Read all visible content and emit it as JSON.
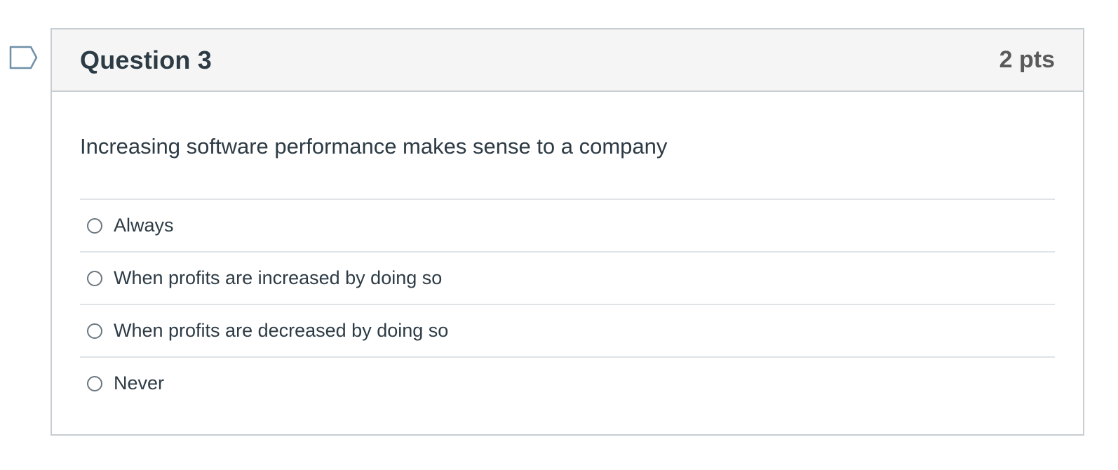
{
  "question": {
    "title": "Question 3",
    "points": "2 pts",
    "text": "Increasing software performance makes sense to a company",
    "flag_icon": "flag-question-icon",
    "answers": [
      {
        "label": "Always",
        "selected": false
      },
      {
        "label": "When profits are increased by doing so",
        "selected": false
      },
      {
        "label": "When profits are decreased by doing so",
        "selected": false
      },
      {
        "label": "Never",
        "selected": false
      }
    ]
  },
  "colors": {
    "header_bg": "#f5f5f5",
    "border": "#c7cdd1",
    "text": "#2d3b45",
    "points_text": "#5a5a5a",
    "flag_stroke": "#6e8fa8"
  }
}
